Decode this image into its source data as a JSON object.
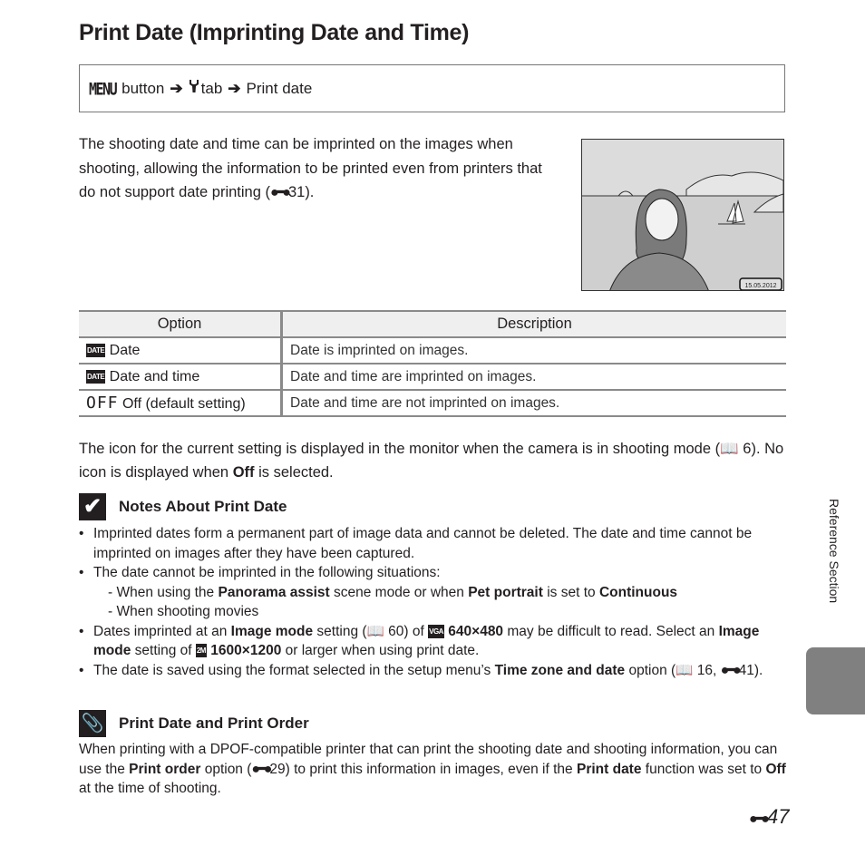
{
  "title": "Print Date (Imprinting Date and Time)",
  "menu_path": {
    "menu_label": "MENU",
    "button_text": "button",
    "arrow": "➔",
    "tab_icon": "wrench-icon",
    "tab_text": "tab",
    "destination": "Print date"
  },
  "intro": {
    "text": "The shooting date and time can be imprinted on the images when shooting, allowing the information to be printed even from printers that do not support date printing (",
    "ref": "31",
    "close": ")."
  },
  "photo": {
    "alt": "Illustration of woman by the sea with sailboat",
    "date_stamp": "15.05.2012"
  },
  "table": {
    "headers": [
      "Option",
      "Description"
    ],
    "rows": [
      {
        "icon": "DATE",
        "icon_name": "date-icon",
        "option": "Date",
        "description": "Date is imprinted on images."
      },
      {
        "icon": "DATE",
        "icon_name": "date-time-icon",
        "option": "Date and time",
        "description": "Date and time are imprinted on images."
      },
      {
        "icon": "OFF",
        "icon_name": "off-icon",
        "option": "Off (default setting)",
        "description": "Date and time are not imprinted on images."
      }
    ]
  },
  "after_table": {
    "part1": "The icon for the current setting is displayed in the monitor when the camera is in shooting mode (",
    "ref": "6",
    "part2": "). No icon is displayed when ",
    "bold": "Off",
    "part3": " is selected."
  },
  "notes": {
    "heading": "Notes About Print Date",
    "b1": "Imprinted dates form a permanent part of image data and cannot be deleted. The date and time cannot be imprinted on images after they have been captured.",
    "b2": "The date cannot be imprinted in the following situations:",
    "b2_sub1_a": "When using the ",
    "b2_sub1_b1": "Panorama assist",
    "b2_sub1_c": " scene mode or when ",
    "b2_sub1_b2": "Pet portrait",
    "b2_sub1_d": " is set to ",
    "b2_sub1_b3": "Continuous",
    "b2_sub2": "When shooting movies",
    "b3_a": "Dates imprinted at an ",
    "b3_b1": "Image mode",
    "b3_c": " setting (",
    "b3_ref": "60",
    "b3_d": ") of ",
    "b3_icon1": "VGA",
    "b3_b2": "640×480",
    "b3_e": " may be difficult to read. Select an ",
    "b3_b3": "Image mode",
    "b3_f": " setting of ",
    "b3_icon2": "2M",
    "b3_b4": "1600×1200",
    "b3_g": " or larger when using print date.",
    "b4_a": "The date is saved using the format selected in the setup menu’s ",
    "b4_b": "Time zone and date",
    "b4_c": " option (",
    "b4_ref1": "16",
    "b4_ref2": "41",
    "b4_d": ")."
  },
  "tip": {
    "heading": "Print Date and Print Order",
    "a": "When printing with a DPOF-compatible printer that can print the shooting date and shooting information, you can use the ",
    "b1": "Print order",
    "c": " option (",
    "ref": "29",
    "d": ") to print this information in images, even if the ",
    "b2": "Print date",
    "e": " function was set to ",
    "b3": "Off",
    "f": " at the time of shooting."
  },
  "side_tab": {
    "label": "Reference Section"
  },
  "page_number": {
    "prefix": "E",
    "number": "47"
  }
}
